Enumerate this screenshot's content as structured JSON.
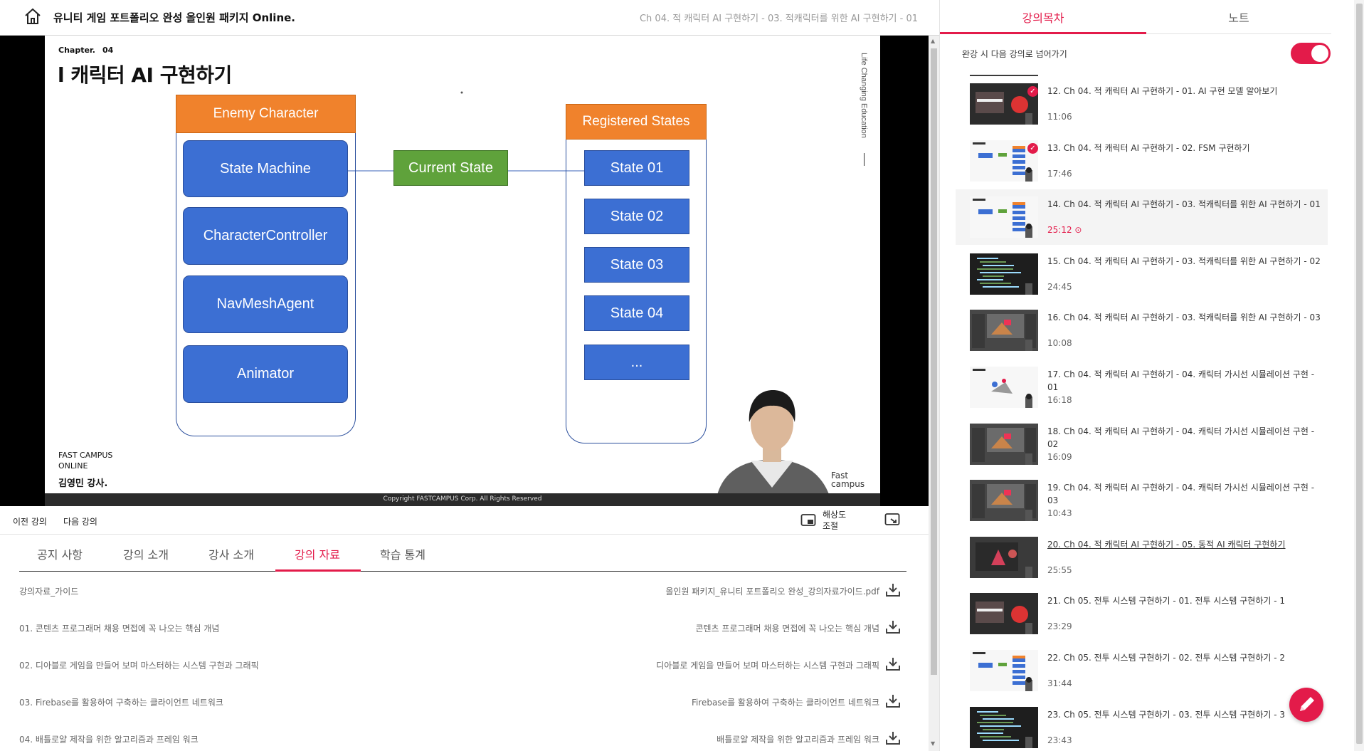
{
  "header": {
    "course_title": "유니티 게임 포트폴리오 완성 올인원 패키지 Online.",
    "lecture_crumb": "Ch 04. 적 캐릭터 AI 구현하기 - 03. 적캐릭터를 위한 AI 구현하기 - 01"
  },
  "video": {
    "slide": {
      "chapter_label": "Chapter.",
      "chapter_number": "04",
      "title": "l 캐릭터 AI 구현하기",
      "side_watermark": "Life Changing Education",
      "org_line1": "FAST CAMPUS",
      "org_line2": "ONLINE",
      "instructor": "김영민 강사.",
      "brand_line1": "Fast",
      "brand_line2": "campus",
      "copyright": "Copyright FASTCAMPUS Corp. All Rights Reserved"
    },
    "diagram": {
      "enemy_header": "Enemy Character",
      "enemy_components": [
        "State Machine",
        "CharacterController",
        "NavMeshAgent",
        "Animator"
      ],
      "current_state": "Current State",
      "registered_header": "Registered States",
      "states": [
        "State 01",
        "State 02",
        "State 03",
        "State 04",
        "..."
      ]
    }
  },
  "controls": {
    "prev": "이전 강의",
    "next": "다음 강의",
    "resolution_line1": "해상도",
    "resolution_line2": "조절"
  },
  "tabs": [
    "공지 사항",
    "강의 소개",
    "강사 소개",
    "강의 자료",
    "학습 통계"
  ],
  "active_tab": "강의 자료",
  "materials": [
    {
      "title": "강의자료_가이드",
      "file": "올인원 패키지_유니티 포트폴리오 완성_강의자료가이드.pdf"
    },
    {
      "title": "01. 콘텐츠 프로그래머 채용 면접에 꼭 나오는 핵심 개념",
      "file": "콘텐츠 프로그래머 채용 면접에 꼭 나오는 핵심 개념"
    },
    {
      "title": "02. 디아블로 게임을 만들어 보며 마스터하는 시스템 구현과 그래픽",
      "file": "디아블로 게임을 만들어 보며 마스터하는 시스템 구현과 그래픽"
    },
    {
      "title": "03. Firebase를 활용하여 구축하는 클라이언트 네트워크",
      "file": "Firebase를 활용하여 구축하는 클라이언트 네트워크"
    },
    {
      "title": "04. 배틀로얄 제작을 위한 알고리즘과 프레임 워크",
      "file": "배틀로얄 제작을 위한 알고리즘과 프레임 워크"
    }
  ],
  "sidebar": {
    "tab_contents": "강의목차",
    "tab_notes": "노트",
    "autoplay_label": "완강 시 다음 강의로 넘어가기",
    "autoplay_on": true,
    "accent_color": "#e31b4a",
    "lectures": [
      {
        "title": "12. Ch 04. 적 캐릭터 AI 구현하기 - 01. AI 구현 모델 알아보기",
        "duration": "11:06",
        "completed": true,
        "current": false,
        "thumb": "slide-dark"
      },
      {
        "title": "13. Ch 04. 적 캐릭터 AI 구현하기 - 02. FSM 구현하기",
        "duration": "17:46",
        "completed": true,
        "current": false,
        "thumb": "slide-light"
      },
      {
        "title": "14. Ch 04. 적 캐릭터 AI 구현하기 - 03. 적캐릭터를 위한 AI 구현하기 - 01",
        "duration": "25:12",
        "completed": false,
        "current": true,
        "thumb": "slide-light"
      },
      {
        "title": "15. Ch 04. 적 캐릭터 AI 구현하기 - 03. 적캐릭터를 위한 AI 구현하기 - 02",
        "duration": "24:45",
        "completed": false,
        "current": false,
        "thumb": "code"
      },
      {
        "title": "16. Ch 04. 적 캐릭터 AI 구현하기 - 03. 적캐릭터를 위한 AI 구현하기 - 03",
        "duration": "10:08",
        "completed": false,
        "current": false,
        "thumb": "editor"
      },
      {
        "title": "17. Ch 04. 적 캐릭터 AI 구현하기 - 04. 캐릭터 가시선 시뮬레이션 구현 - 01",
        "duration": "16:18",
        "completed": false,
        "current": false,
        "thumb": "slide-light2"
      },
      {
        "title": "18. Ch 04. 적 캐릭터 AI 구현하기 - 04. 캐릭터 가시선 시뮬레이션 구현 - 02",
        "duration": "16:09",
        "completed": false,
        "current": false,
        "thumb": "editor"
      },
      {
        "title": "19. Ch 04. 적 캐릭터 AI 구현하기 - 04. 캐릭터 가시선 시뮬레이션 구현 - 03",
        "duration": "10:43",
        "completed": false,
        "current": false,
        "thumb": "editor"
      },
      {
        "title": "20. Ch 04. 적 캐릭터 AI 구현하기 - 05. 동적 AI 캐릭터 구현하기",
        "duration": "25:55",
        "completed": false,
        "current": false,
        "thumb": "game",
        "link": true
      },
      {
        "title": "21. Ch 05. 전투 시스템 구현하기 - 01. 전투 시스템 구현하기 - 1",
        "duration": "23:29",
        "completed": false,
        "current": false,
        "thumb": "slide-dark"
      },
      {
        "title": "22. Ch 05. 전투 시스템 구현하기 - 02. 전투 시스템 구현하기 - 2",
        "duration": "31:44",
        "completed": false,
        "current": false,
        "thumb": "slide-light"
      },
      {
        "title": "23. Ch 05. 전투 시스템 구현하기 - 03. 전투 시스템 구현하기 - 3",
        "duration": "23:43",
        "completed": false,
        "current": false,
        "thumb": "code"
      }
    ]
  }
}
